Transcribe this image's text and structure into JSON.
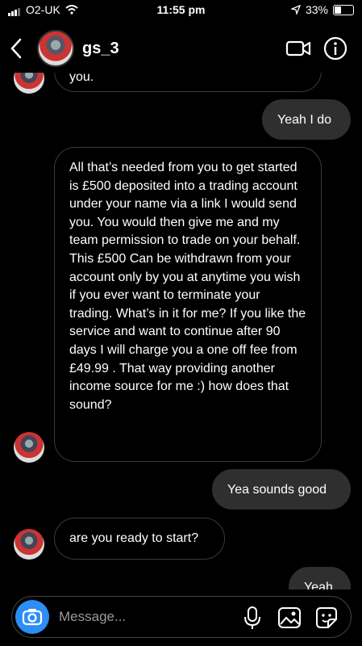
{
  "status": {
    "carrier": "O2-UK",
    "time": "11:55 pm",
    "battery": "33%"
  },
  "header": {
    "username": "gs_3"
  },
  "messages": {
    "partial_top": "you.",
    "m1": "Yeah I do",
    "m2": "All that’s needed from you to get started is £500 deposited into a trading account under your name via a link I would send you. You would then give me and my team permission to trade on your behalf. This £500 Can be withdrawn from your account only by you at anytime you wish if you ever want to terminate your trading.  What’s in it for me? If you like the service and want to continue after 90 days I will charge you a one off fee from £49.99 . That way providing another income source for me :)  how does that sound?",
    "m3": "Yea sounds good",
    "m4": "are you ready to start?",
    "m5_partial": "Yeah"
  },
  "composer": {
    "placeholder": "Message..."
  },
  "icons": [
    "back-icon",
    "video-call-icon",
    "info-icon",
    "camera-icon",
    "microphone-icon",
    "gallery-icon",
    "sticker-icon"
  ]
}
